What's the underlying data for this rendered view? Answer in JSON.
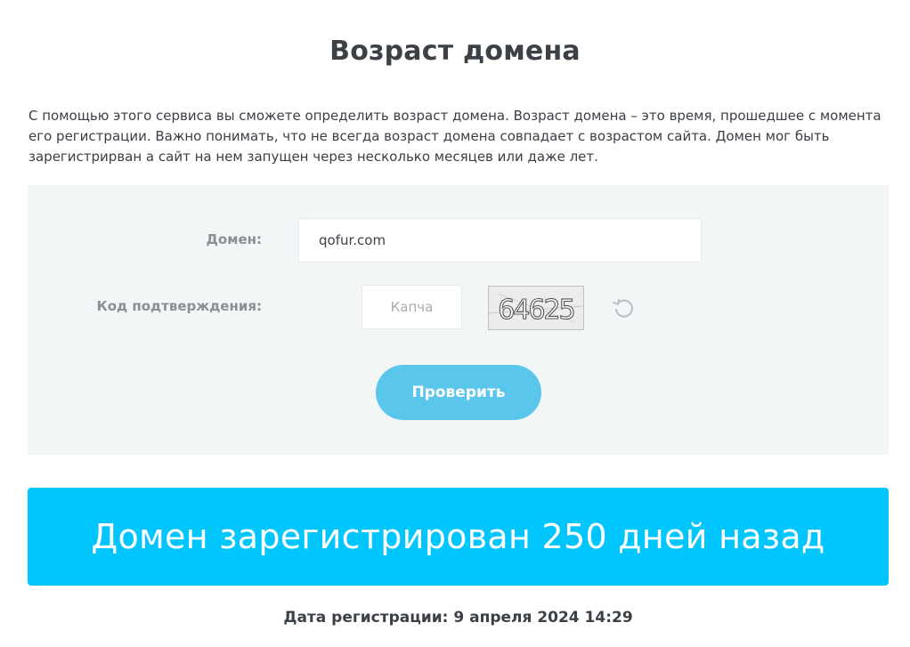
{
  "page": {
    "title": "Возраст домена",
    "intro": "С помощью этого сервиса вы сможете определить возраст домена. Возраст домена – это время, прошедшее с момента его регистрации. Важно понимать, что не всегда возраст домена совпадает с возрастом сайта. Домен мог быть зарегистрирван а сайт на нем запущен через несколько месяцев или даже лет."
  },
  "form": {
    "domain_label": "Домен:",
    "domain_value": "qofur.com",
    "code_label": "Код подтверждения:",
    "captcha_placeholder": "Капча",
    "captcha_text": "64625",
    "refresh_icon": "refresh-icon",
    "submit_label": "Проверить"
  },
  "result": {
    "message": "Домен зарегистрирован 250 дней назад",
    "registration_date": "Дата регистрации: 9 апреля 2024 14:29"
  },
  "colors": {
    "button": "#5bc6ec",
    "banner": "#00c6fd",
    "panel": "#f3f6f7"
  }
}
